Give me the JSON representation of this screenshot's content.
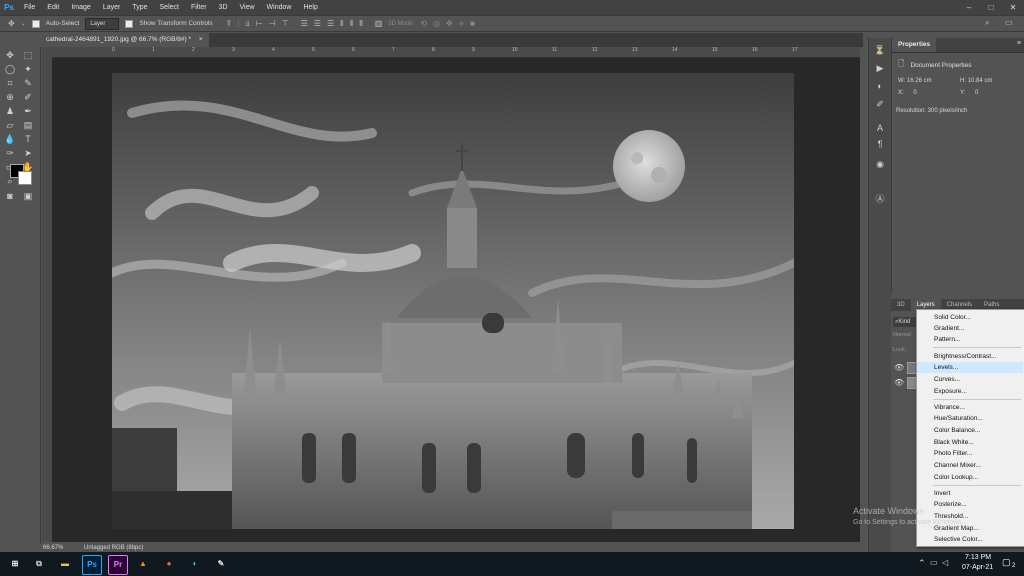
{
  "app": {
    "logo": "Ps",
    "accent": "#31a8ff"
  },
  "menu": [
    "File",
    "Edit",
    "Image",
    "Layer",
    "Type",
    "Select",
    "Filter",
    "3D",
    "View",
    "Window",
    "Help"
  ],
  "window_controls": [
    "–",
    "□",
    "✕"
  ],
  "options": {
    "auto_select_label": "Auto-Select",
    "auto_select_value": "Layer",
    "transform_label": "Show Transform Controls",
    "mode_3d_label": "3D Mode:"
  },
  "document": {
    "tab_title": "cathedral-2464891_1920.jpg @ 66.7% (RGB/8#) *",
    "tab_close": "×",
    "zoom": "66.67%",
    "profile": "Untagged RGB (8bpc)"
  },
  "ruler_ticks": [
    "0",
    "1",
    "2",
    "3",
    "4",
    "5",
    "6",
    "7",
    "8",
    "9",
    "10",
    "11",
    "12",
    "13",
    "14",
    "15",
    "16",
    "17"
  ],
  "properties": {
    "tab": "Properties",
    "section": "Document Properties",
    "w_label": "W:",
    "w_value": "16.26 cm",
    "h_label": "H:",
    "h_value": "10.84 cm",
    "x_label": "X:",
    "x_value": "0",
    "y_label": "Y:",
    "y_value": "0",
    "resolution": "Resolution: 300 pixels/inch"
  },
  "layers_panel": {
    "tabs": [
      "3D",
      "Layers",
      "Channels",
      "Paths"
    ],
    "kind": "Kind",
    "mode": "Normal",
    "lock": "Lock:"
  },
  "adjustment_menu": {
    "groups": [
      [
        "Solid Color...",
        "Gradient...",
        "Pattern..."
      ],
      [
        "Brightness/Contrast...",
        "Levels...",
        "Curves...",
        "Exposure..."
      ],
      [
        "Vibrance...",
        "Hue/Saturation...",
        "Color Balance...",
        "Black  White...",
        "Photo Filter...",
        "Channel Mixer...",
        "Color Lookup..."
      ],
      [
        "Invert",
        "Posterize...",
        "Threshold...",
        "Gradient Map...",
        "Selective Color..."
      ]
    ],
    "highlighted": "Levels...",
    "highlight_color": "#cde8ff"
  },
  "watermark": {
    "line1": "Activate Windows",
    "line2": "Go to Settings to activate Windows."
  },
  "taskbar": {
    "time": "7:13 PM",
    "date": "07-Apr-21",
    "notification_count": "2",
    "app_labels": [
      "Ps",
      "Pr"
    ]
  }
}
